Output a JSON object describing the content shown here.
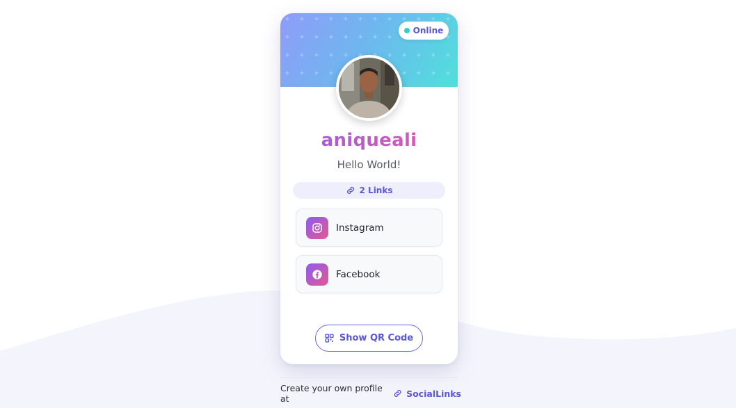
{
  "status": {
    "label": "Online",
    "color": "#35d0c0"
  },
  "profile": {
    "username": "aniqueali",
    "bio": "Hello World!",
    "avatar_icon": "profile-photo"
  },
  "links_summary": {
    "label": "2 Links",
    "icon": "link-icon"
  },
  "links": [
    {
      "label": "Instagram",
      "icon": "instagram-icon"
    },
    {
      "label": "Facebook",
      "icon": "facebook-icon"
    }
  ],
  "qr_button": {
    "label": "Show QR Code",
    "icon": "qr-code-icon"
  },
  "footer": {
    "text": "Create your own profile at",
    "brand": "SocialLinks",
    "icon": "link-icon"
  },
  "colors": {
    "accent": "#5a57d8",
    "gradient_start": "#8f9cf8",
    "gradient_end": "#4fe0dc",
    "name_gradient_start": "#9b5ee3",
    "name_gradient_end": "#e05aa8"
  }
}
